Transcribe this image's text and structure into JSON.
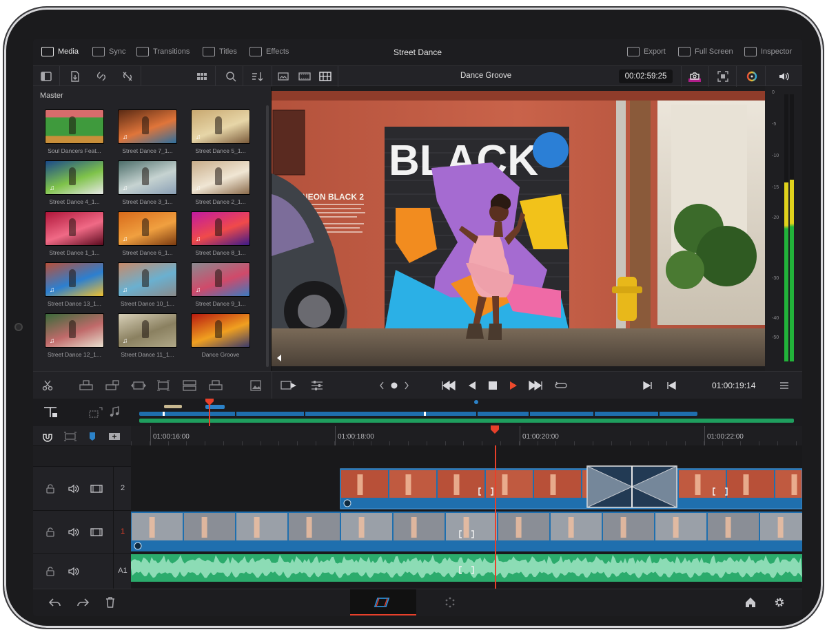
{
  "app": {
    "project_title": "Street Dance"
  },
  "pages": [
    {
      "label": "Media",
      "icon": "media-pool-icon",
      "active": true
    },
    {
      "label": "Sync",
      "icon": "sync-bin-icon",
      "active": false
    },
    {
      "label": "Transitions",
      "icon": "transitions-icon",
      "active": false
    },
    {
      "label": "Titles",
      "icon": "titles-icon",
      "active": false
    },
    {
      "label": "Effects",
      "icon": "effects-icon",
      "active": false
    }
  ],
  "right_actions": [
    {
      "label": "Export",
      "icon": "export-icon"
    },
    {
      "label": "Full Screen",
      "icon": "fullscreen-icon"
    },
    {
      "label": "Inspector",
      "icon": "inspector-icon"
    }
  ],
  "viewer": {
    "clip_name": "Dance Groove",
    "duration_timecode": "00:02:59:25",
    "playhead_timecode": "01:00:19:14"
  },
  "media_pool": {
    "bin_name": "Master",
    "clips": [
      {
        "label": "Soul Dancers Feat...",
        "audio": false,
        "palette": [
          "#3f9a3d",
          "#d76c6c",
          "#c98f3a"
        ]
      },
      {
        "label": "Street Dance 7_1...",
        "audio": true,
        "palette": [
          "#5a2a14",
          "#e0753a",
          "#2c6fa0"
        ]
      },
      {
        "label": "Street Dance 5_1...",
        "audio": true,
        "palette": [
          "#c8a870",
          "#e7d6a8",
          "#7a5a3a"
        ]
      },
      {
        "label": "Street Dance 4_1...",
        "audio": true,
        "palette": [
          "#1b4a8a",
          "#7fc34a",
          "#e8e8e8"
        ]
      },
      {
        "label": "Street Dance 3_1...",
        "audio": true,
        "palette": [
          "#4d6e6a",
          "#c6d3d1",
          "#8a9fb5"
        ]
      },
      {
        "label": "Street Dance 2_1...",
        "audio": true,
        "palette": [
          "#c8ad8a",
          "#f0e6d4",
          "#8a6a4a"
        ]
      },
      {
        "label": "Street Dance 1_1...",
        "audio": false,
        "palette": [
          "#b0163a",
          "#f06a86",
          "#5a0a1e"
        ]
      },
      {
        "label": "Street Dance 6_1...",
        "audio": true,
        "palette": [
          "#d86a1a",
          "#f0a040",
          "#7a3a10"
        ]
      },
      {
        "label": "Street Dance 8_1...",
        "audio": true,
        "palette": [
          "#c01aa0",
          "#f04a4a",
          "#3a1a8a"
        ]
      },
      {
        "label": "Street Dance 13_1...",
        "audio": true,
        "palette": [
          "#b8503a",
          "#2c7fd0",
          "#f0c030"
        ]
      },
      {
        "label": "Street Dance 10_1...",
        "audio": true,
        "palette": [
          "#c88a6a",
          "#6ab0d0",
          "#8a8a8a"
        ]
      },
      {
        "label": "Street Dance 9_1...",
        "audio": true,
        "palette": [
          "#8a8a90",
          "#d04a6a",
          "#3a7ac0"
        ]
      },
      {
        "label": "Street Dance 12_1...",
        "audio": true,
        "palette": [
          "#3a6a3a",
          "#c06a6a",
          "#e8e0d0"
        ]
      },
      {
        "label": "Street Dance 11_1...",
        "audio": true,
        "palette": [
          "#d8d0b8",
          "#8a8060",
          "#b0a888"
        ]
      },
      {
        "label": "Dance Groove",
        "audio": false,
        "palette": [
          "#b81a10",
          "#f0a020",
          "#3a3a6a"
        ]
      }
    ]
  },
  "meters": {
    "scale": [
      "0",
      "-5",
      "-10",
      "-15",
      "-20",
      "-30",
      "-40",
      "-50"
    ],
    "level_left": 0.67,
    "level_right": 0.68,
    "colors": {
      "green": "#22b33a",
      "yellow": "#e0d21c"
    }
  },
  "timeline": {
    "ruler": [
      "01:00:16:00",
      "01:00:18:00",
      "01:00:20:00",
      "01:00:22:00"
    ],
    "tracks": [
      {
        "id": "V2",
        "label": "2"
      },
      {
        "id": "V1",
        "label": "1"
      },
      {
        "id": "A1",
        "label": "A1"
      }
    ]
  },
  "colors": {
    "accent_red": "#e8402a",
    "clip_blue": "#1f6fae",
    "audio_green": "#2bab6c",
    "background": "#1c1c1e"
  }
}
